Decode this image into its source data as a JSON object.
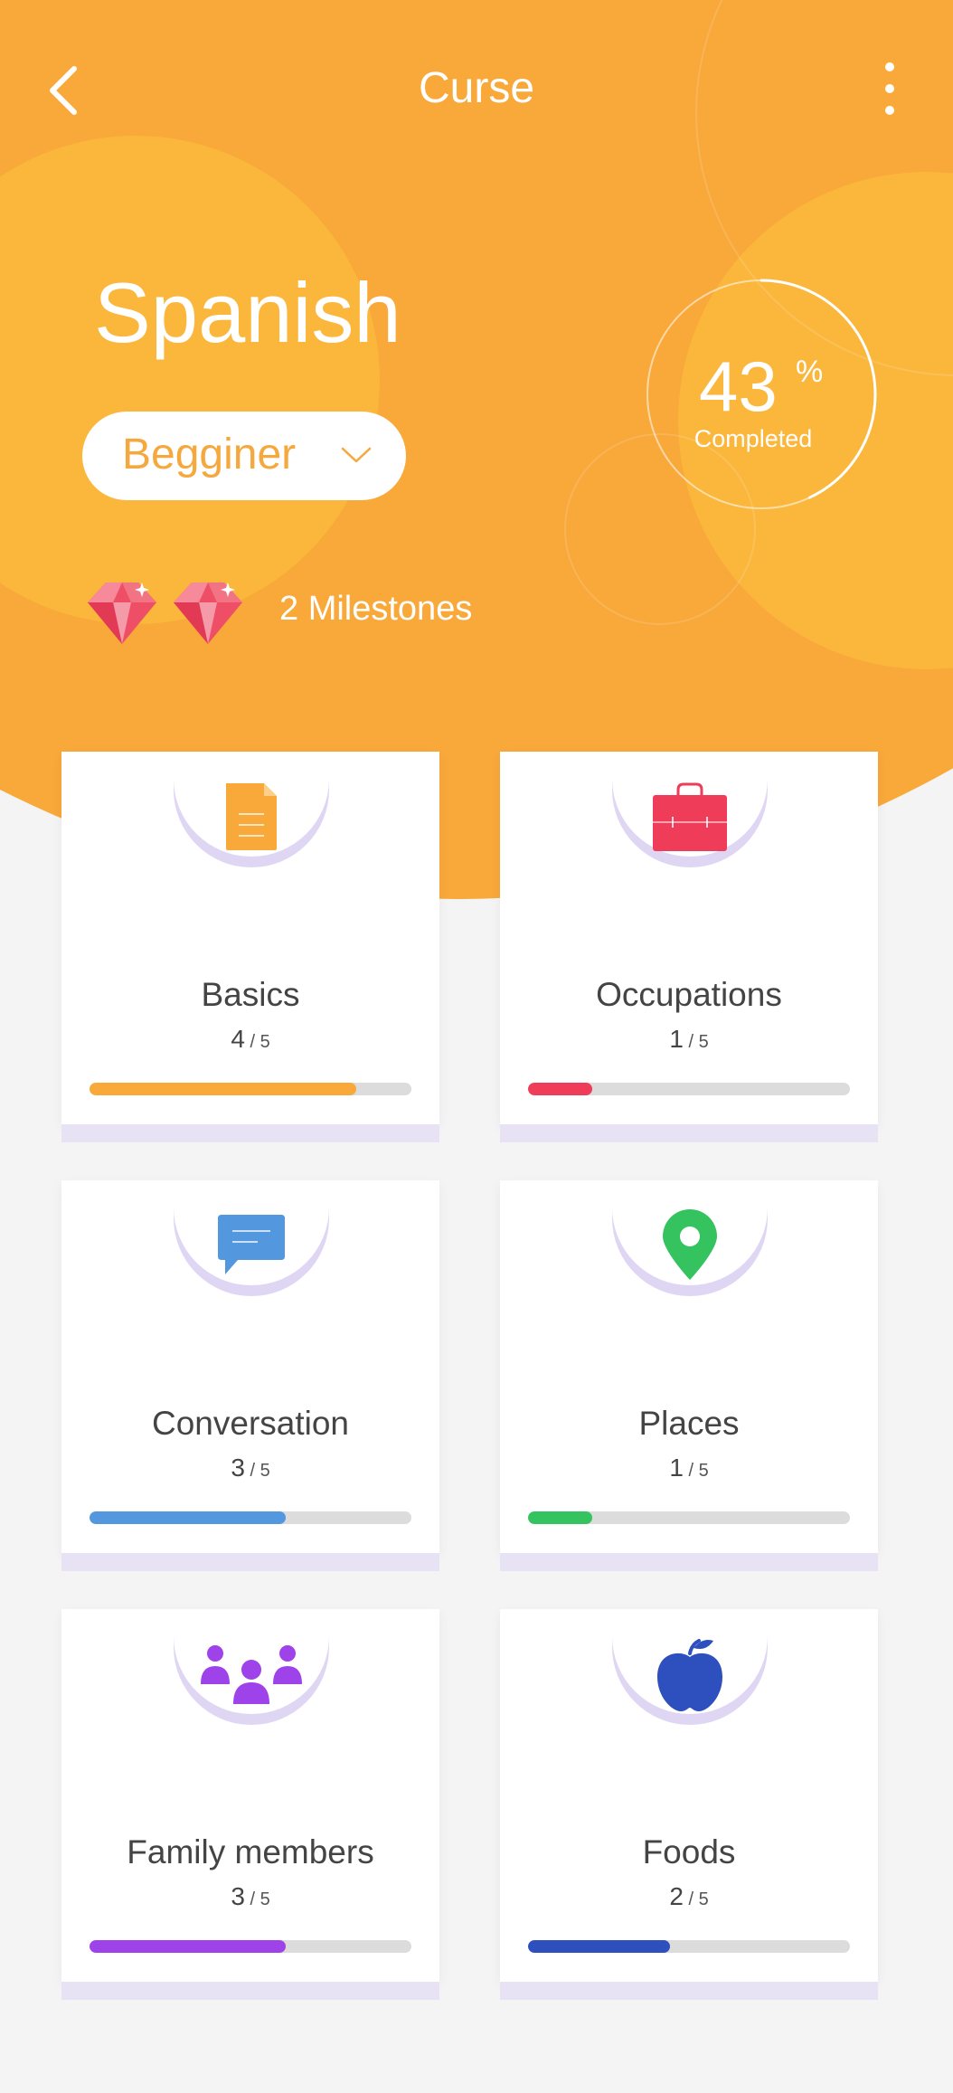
{
  "header": {
    "title": "Curse",
    "language": "Spanish",
    "level": "Begginer",
    "progress": {
      "value": "43",
      "unit": "%",
      "caption": "Completed",
      "fraction": 0.43
    },
    "milestones_label": "2 Milestones"
  },
  "icons": {
    "back": "back-arrow-icon",
    "more": "more-vertical-icon",
    "level": "chevron-down-icon",
    "milestone": "gem-icon"
  },
  "colors": {
    "brand": "#f9a83a",
    "basics": "#f9a83a",
    "occupations": "#ee3c59",
    "conversation": "#5397de",
    "places": "#35c35f",
    "family": "#9e42e9",
    "foods": "#2e4fbe"
  },
  "cards": [
    {
      "title": "Basics",
      "done": "4",
      "total": "5",
      "fraction": 0.83,
      "icon": "document-icon",
      "color": "#f9a83a"
    },
    {
      "title": "Occupations",
      "done": "1",
      "total": "5",
      "fraction": 0.2,
      "icon": "briefcase-icon",
      "color": "#ee3c59"
    },
    {
      "title": "Conversation",
      "done": "3",
      "total": "5",
      "fraction": 0.61,
      "icon": "chat-bubble-icon",
      "color": "#5397de"
    },
    {
      "title": "Places",
      "done": "1",
      "total": "5",
      "fraction": 0.2,
      "icon": "location-pin-icon",
      "color": "#35c35f"
    },
    {
      "title": "Family members",
      "done": "3",
      "total": "5",
      "fraction": 0.61,
      "icon": "people-icon",
      "color": "#9e42e9"
    },
    {
      "title": "Foods",
      "done": "2",
      "total": "5",
      "fraction": 0.44,
      "icon": "apple-icon",
      "color": "#2e4fbe"
    }
  ]
}
